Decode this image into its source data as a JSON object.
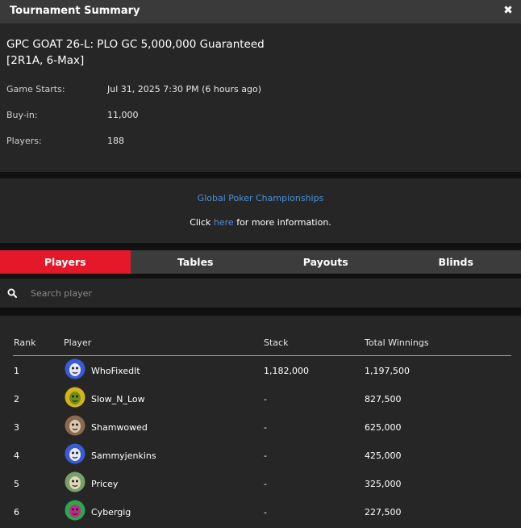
{
  "window": {
    "title": "Tournament Summary",
    "close_icon": "close-icon"
  },
  "tournament": {
    "name": "GPC GOAT 26-L: PLO GC 5,000,000 Guaranteed [2R1A, 6-Max]",
    "game_starts_label": "Game Starts:",
    "game_starts_value": "Jul 31, 2025 7:30 PM (6 hours ago)",
    "buyin_label": "Buy-in:",
    "buyin_value": "11,000",
    "players_label": "Players:",
    "players_value": "188"
  },
  "promo": {
    "link_text": "Global Poker Championships",
    "click_text": "Click ",
    "here_text": "here",
    "more_text": " for more information."
  },
  "tabs": [
    {
      "label": "Players",
      "active": true
    },
    {
      "label": "Tables",
      "active": false
    },
    {
      "label": "Payouts",
      "active": false
    },
    {
      "label": "Blinds",
      "active": false
    }
  ],
  "search": {
    "placeholder": "Search player",
    "icon": "search-icon"
  },
  "table": {
    "headers": [
      "Rank",
      "Player",
      "Stack",
      "Total Winnings"
    ],
    "rows": [
      {
        "rank": "1",
        "player": "WhoFixedIt",
        "stack": "1,182,000",
        "winnings": "1,197,500",
        "avatar_colors": [
          "#3a5bd6",
          "#e8e8f0"
        ]
      },
      {
        "rank": "2",
        "player": "Slow_N_Low",
        "stack": "-",
        "winnings": "827,500",
        "avatar_colors": [
          "#d6b21a",
          "#6b8f1a"
        ]
      },
      {
        "rank": "3",
        "player": "Shamwowed",
        "stack": "-",
        "winnings": "625,000",
        "avatar_colors": [
          "#8a6a4a",
          "#d8c8b0"
        ]
      },
      {
        "rank": "4",
        "player": "Sammyjenkins",
        "stack": "-",
        "winnings": "425,000",
        "avatar_colors": [
          "#3a5bd6",
          "#e8e8f0"
        ]
      },
      {
        "rank": "5",
        "player": "Pricey",
        "stack": "-",
        "winnings": "325,000",
        "avatar_colors": [
          "#7aa06a",
          "#e0d8b8"
        ]
      },
      {
        "rank": "6",
        "player": "Cybergig",
        "stack": "-",
        "winnings": "227,500",
        "avatar_colors": [
          "#2aa84a",
          "#c02a8a"
        ]
      }
    ]
  },
  "colors": {
    "accent": "#e5182a",
    "link": "#4a90d9",
    "panel": "#262626",
    "background": "#111111"
  }
}
